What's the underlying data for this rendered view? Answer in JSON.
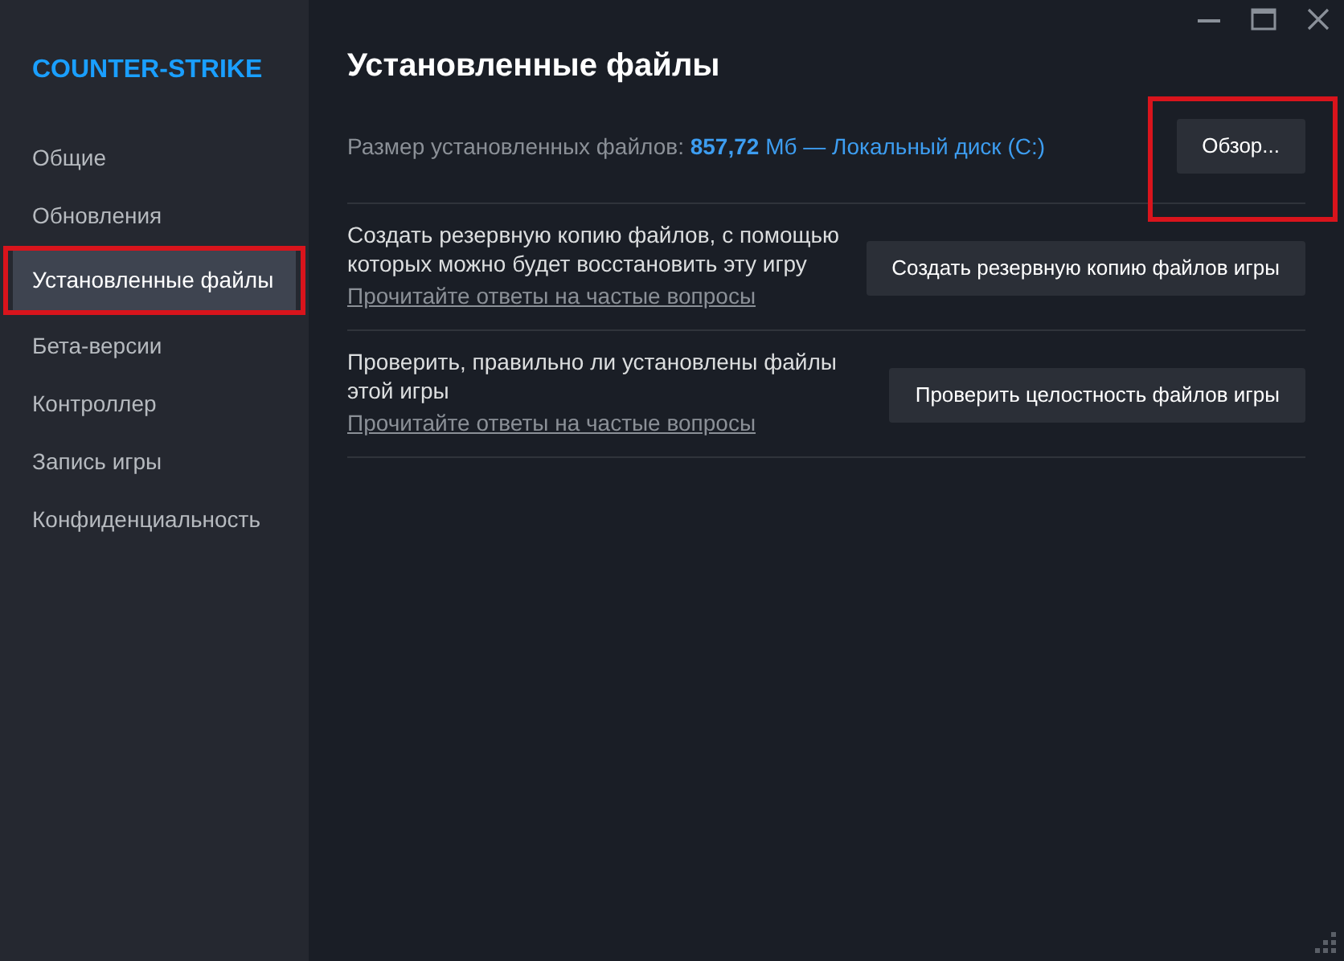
{
  "window": {
    "controls": [
      {
        "kind": "minimize"
      },
      {
        "kind": "maximize"
      },
      {
        "kind": "close"
      }
    ]
  },
  "sidebar": {
    "title": "COUNTER-STRIKE",
    "items": [
      {
        "label": "Общие",
        "selected": false,
        "highlighted": false
      },
      {
        "label": "Обновления",
        "selected": false,
        "highlighted": false
      },
      {
        "label": "Установленные файлы",
        "selected": true,
        "highlighted": true
      },
      {
        "label": "Бета-версии",
        "selected": false,
        "highlighted": false
      },
      {
        "label": "Контроллер",
        "selected": false,
        "highlighted": false
      },
      {
        "label": "Запись игры",
        "selected": false,
        "highlighted": false
      },
      {
        "label": "Конфиденциальность",
        "selected": false,
        "highlighted": false
      }
    ]
  },
  "page": {
    "title": "Установленные файлы",
    "size": {
      "label": "Размер установленных файлов:",
      "value": "**857,72** Мб — Локальный диск (С:)",
      "button": "Обзор...",
      "highlighted": true
    },
    "actions": [
      {
        "description": "Создать резервную копию файлов, с помощью которых можно будет восстановить эту игру",
        "link": "Прочитайте ответы на частые вопросы",
        "button": "Создать резервную копию файлов игры"
      },
      {
        "description": "Проверить, правильно ли установлены файлы этой игры",
        "link": "Прочитайте ответы на частые вопросы",
        "button": "Проверить целостность файлов игры"
      }
    ]
  }
}
